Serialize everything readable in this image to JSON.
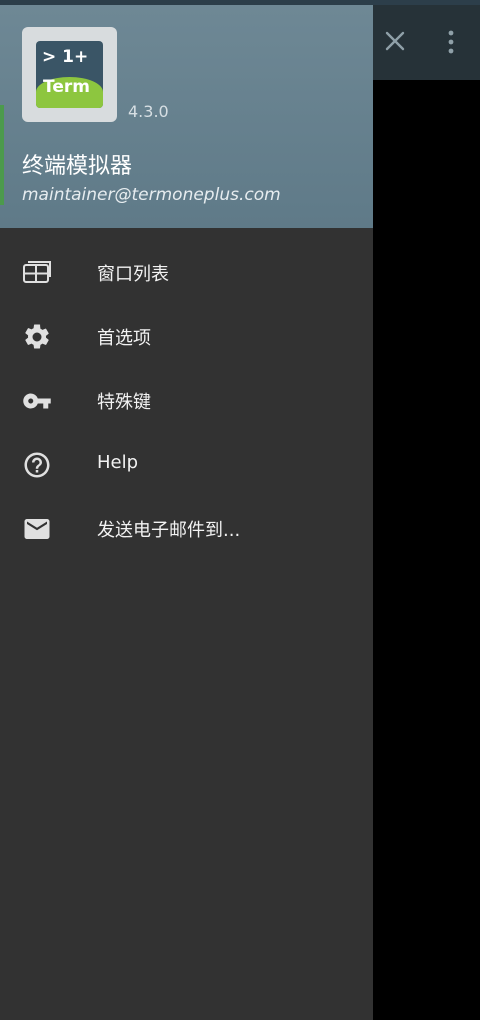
{
  "drawer": {
    "header": {
      "icon_text_line1": "> 1+",
      "icon_text_line2": "Term",
      "version": "4.3.0",
      "app_name": "终端模拟器",
      "email": "maintainer@termoneplus.com"
    },
    "items": [
      {
        "label": "窗口列表",
        "icon": "window-list-icon"
      },
      {
        "label": "首选项",
        "icon": "gear-icon"
      },
      {
        "label": "特殊键",
        "icon": "key-icon"
      },
      {
        "label": "Help",
        "icon": "help-icon"
      },
      {
        "label": "发送电子邮件到...",
        "icon": "mail-icon"
      }
    ]
  },
  "toolbar": {
    "close_icon": "close-icon",
    "menu_icon": "more-vert-icon"
  },
  "colors": {
    "drawer_bg": "#323232",
    "header_bg": "#6e8895",
    "toolbar_bg": "#263238",
    "icon_green": "#8dc63f"
  }
}
